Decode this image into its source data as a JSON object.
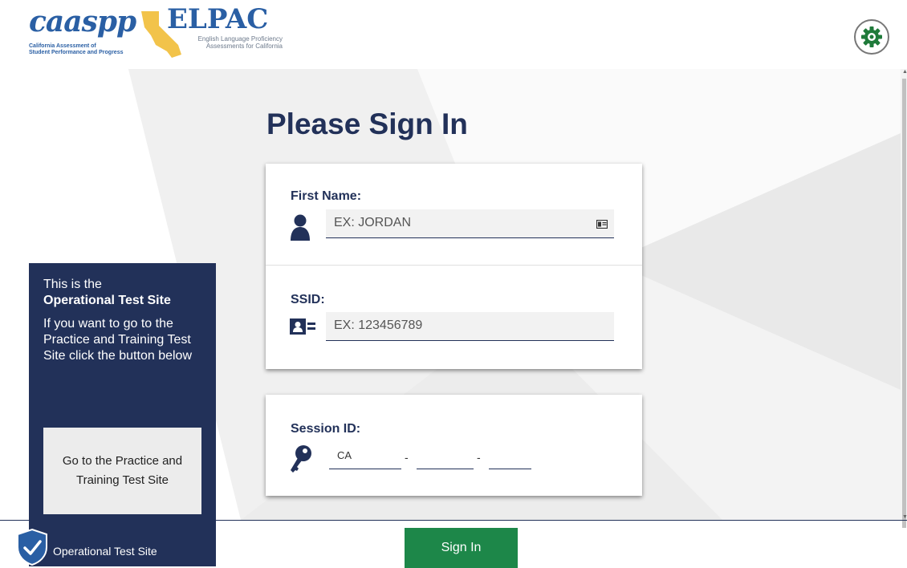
{
  "header": {
    "caaspp_logo_text": "caaspp",
    "caaspp_subtitle_line1": "California Assessment of",
    "caaspp_subtitle_line2": "Student Performance and Progress",
    "elpac_title": "ELPAC",
    "elpac_subtitle_line1": "English Language Proficiency",
    "elpac_subtitle_line2": "Assessments for California",
    "settings_icon": "gear-icon"
  },
  "main": {
    "title": "Please Sign In",
    "first_name": {
      "label": "First Name:",
      "placeholder": "EX: JORDAN",
      "icon": "person-icon",
      "trailing_icon": "id-card-icon"
    },
    "ssid": {
      "label": "SSID:",
      "placeholder": "EX: 123456789",
      "icon": "id-badge-icon"
    },
    "session_id": {
      "label": "Session ID:",
      "prefix_value": "CA",
      "separator": "-",
      "icon": "key-icon"
    }
  },
  "notice": {
    "line1": "This is the",
    "line2": "Operational Test Site",
    "line3": "If you want to go to the Practice and Training Test Site click the button below",
    "button": "Go to the Practice and Training Test Site"
  },
  "footer": {
    "site_label": "Operational Test Site",
    "sign_in": "Sign In"
  },
  "colors": {
    "navy": "#223159",
    "green": "#1d8749",
    "input_bg": "#f2f2f2"
  }
}
